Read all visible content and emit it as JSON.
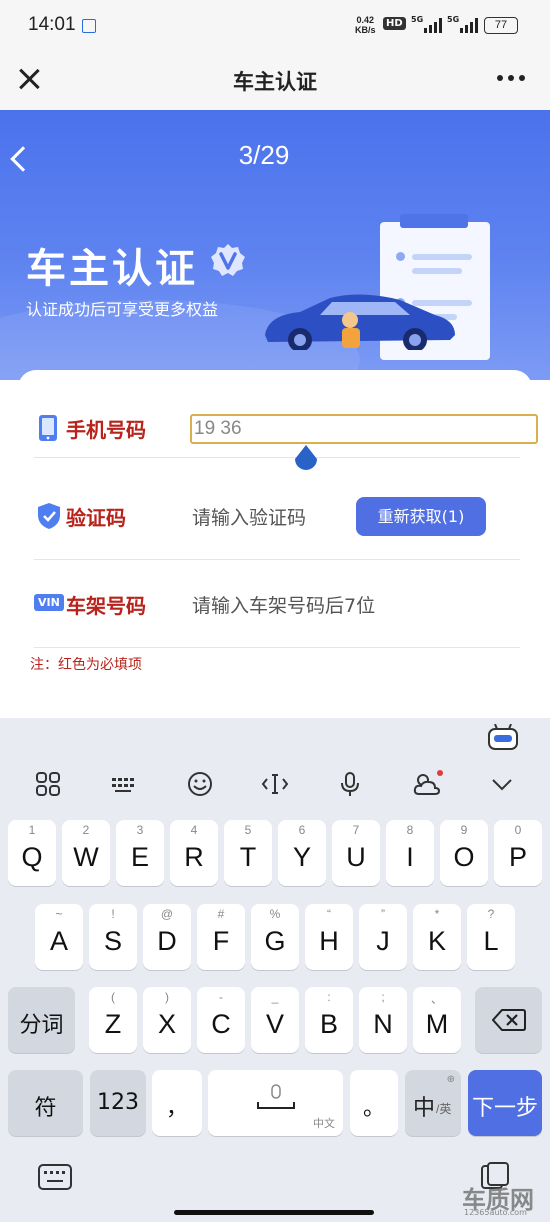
{
  "status": {
    "time": "14:01",
    "speed_top": "0.42",
    "speed_bottom": "KB/s",
    "hd": "HD",
    "sig1": "5G",
    "sig2": "5G",
    "battery": "77"
  },
  "titlebar": {
    "title": "车主认证"
  },
  "banner": {
    "progress": "3/29",
    "title": "车主认证",
    "subtitle": "认证成功后可享受更多权益"
  },
  "form": {
    "phone": {
      "label": "手机号码",
      "value": "19        36"
    },
    "code": {
      "label": "验证码",
      "placeholder": "请输入验证码",
      "button": "重新获取(1)"
    },
    "vin": {
      "badge": "VIN",
      "label": "车架号码",
      "placeholder": "请输入车架号码后7位"
    },
    "note": "注：红色为必填项"
  },
  "keyboard": {
    "row1": [
      {
        "s": "1",
        "m": "Q"
      },
      {
        "s": "2",
        "m": "W"
      },
      {
        "s": "3",
        "m": "E"
      },
      {
        "s": "4",
        "m": "R"
      },
      {
        "s": "5",
        "m": "T"
      },
      {
        "s": "6",
        "m": "Y"
      },
      {
        "s": "7",
        "m": "U"
      },
      {
        "s": "8",
        "m": "I"
      },
      {
        "s": "9",
        "m": "O"
      },
      {
        "s": "0",
        "m": "P"
      }
    ],
    "row2": [
      {
        "s": "~",
        "m": "A"
      },
      {
        "s": "!",
        "m": "S"
      },
      {
        "s": "@",
        "m": "D"
      },
      {
        "s": "#",
        "m": "F"
      },
      {
        "s": "%",
        "m": "G"
      },
      {
        "s": "“",
        "m": "H"
      },
      {
        "s": "”",
        "m": "J"
      },
      {
        "s": "*",
        "m": "K"
      },
      {
        "s": "?",
        "m": "L"
      }
    ],
    "row3": [
      {
        "s": "(",
        "m": "Z"
      },
      {
        "s": ")",
        "m": "X"
      },
      {
        "s": "-",
        "m": "C"
      },
      {
        "s": "_",
        "m": "V"
      },
      {
        "s": ":",
        "m": "B"
      },
      {
        "s": ";",
        "m": "N"
      },
      {
        "s": "、",
        "m": "M"
      }
    ],
    "fenci": "分词",
    "fu": "符",
    "num": "123",
    "comma": "，",
    "space_sub": "中文",
    "period": "。",
    "lang_main": "中",
    "lang_sub": "/英",
    "next": "下一步"
  },
  "watermark": {
    "main": "车质网",
    "sub": "12365auto.com"
  }
}
